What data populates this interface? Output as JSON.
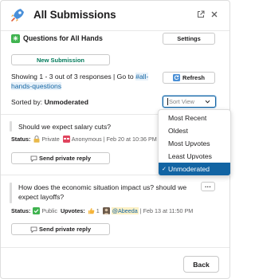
{
  "header": {
    "title": "All Submissions"
  },
  "section": {
    "title": "Questions for All Hands",
    "settings_label": "Settings",
    "new_submission_label": "New Submission"
  },
  "summary": {
    "line1_prefix": "Showing 1 - 3 out of 3 responses | Go to ",
    "channel_part1": "#all-",
    "channel_part2": "hands-questions",
    "refresh_label": "Refresh",
    "sorted_by_label": "Sorted by:",
    "sorted_by_value": "Unmoderated"
  },
  "sort_select": {
    "placeholder": "Sort View"
  },
  "dropdown": {
    "options": [
      "Most Recent",
      "Oldest",
      "Most Upvotes",
      "Least Upvotes",
      "Unmoderated"
    ],
    "selected_index": 4,
    "check": "✓"
  },
  "submissions": [
    {
      "question": "Should we expect salary cuts?",
      "status_label": "Status:",
      "status_value": "Private",
      "author": "Anonymous",
      "date": "Feb 20 at 10:36 PM",
      "reply_label": "Send private reply"
    },
    {
      "question_line1": "How does the economic situation impact us? should we",
      "question_line2": "expect layoffs?",
      "more_label": "···",
      "status_label": "Status:",
      "status_value": "Public",
      "upvotes_label": "Upvotes:",
      "upvotes_count": "1",
      "author": "@Abeeda",
      "date": "Feb 13 at 11:50 PM",
      "reply_label": "Send private reply"
    }
  ],
  "footer": {
    "back_label": "Back"
  },
  "colors": {
    "accent": "#1264a3",
    "green": "#007a5a"
  }
}
